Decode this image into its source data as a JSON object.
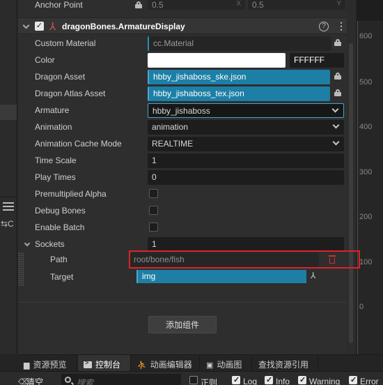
{
  "ruler": {
    "labels": [
      "600",
      "500",
      "400",
      "300",
      "200",
      "100",
      "0"
    ]
  },
  "anchor": {
    "label": "Anchor Point",
    "x": "0.5",
    "x_axis": "X",
    "y": "0.5",
    "y_axis": "Y"
  },
  "component": {
    "title": "dragonBones.ArmatureDisplay",
    "help": "?",
    "more": "⋮"
  },
  "props": {
    "custom_material": {
      "label": "Custom Material",
      "value": "cc.Material"
    },
    "color": {
      "label": "Color",
      "hex": "FFFFFF",
      "swatch": "#ffffff"
    },
    "dragon_asset": {
      "label": "Dragon Asset",
      "value": "hbby_jishaboss_ske.json"
    },
    "dragon_atlas_asset": {
      "label": "Dragon Atlas Asset",
      "value": "hbby_jishaboss_tex.json"
    },
    "armature": {
      "label": "Armature",
      "value": "hbby_jishaboss"
    },
    "animation": {
      "label": "Animation",
      "value": "animation"
    },
    "cache_mode": {
      "label": "Animation Cache Mode",
      "value": "REALTIME"
    },
    "time_scale": {
      "label": "Time Scale",
      "value": "1"
    },
    "play_times": {
      "label": "Play Times",
      "value": "0"
    },
    "premultiplied_alpha": {
      "label": "Premultiplied Alpha",
      "checked": false
    },
    "debug_bones": {
      "label": "Debug Bones",
      "checked": false
    },
    "enable_batch": {
      "label": "Enable Batch",
      "checked": false
    },
    "sockets": {
      "label": "Sockets",
      "value": "1"
    },
    "path": {
      "label": "Path",
      "value": "root/bone/fish"
    },
    "target": {
      "label": "Target",
      "value": "img"
    }
  },
  "add_component": "添加组件",
  "tabs": [
    {
      "label": "资源预览",
      "icon": "folder-icon",
      "active": false
    },
    {
      "label": "控制台",
      "icon": "terminal-icon",
      "active": true
    },
    {
      "label": "动画编辑器",
      "icon": "runner-icon",
      "active": false
    },
    {
      "label": "动画图",
      "icon": "graph-icon",
      "active": false
    },
    {
      "label": "查找资源引用",
      "icon": "",
      "active": false
    }
  ],
  "toolbar": {
    "clear": "清空",
    "search_placeholder": "搜索",
    "filters": [
      {
        "label": "正则",
        "checked": false
      },
      {
        "label": "Log",
        "checked": true
      },
      {
        "label": "Info",
        "checked": true
      },
      {
        "label": "Warning",
        "checked": true
      },
      {
        "label": "Error",
        "checked": true
      }
    ]
  },
  "colors": {
    "accent_blue": "#1d7fa6",
    "highlight_red": "#e0202a",
    "component_icon": "#e05050"
  }
}
